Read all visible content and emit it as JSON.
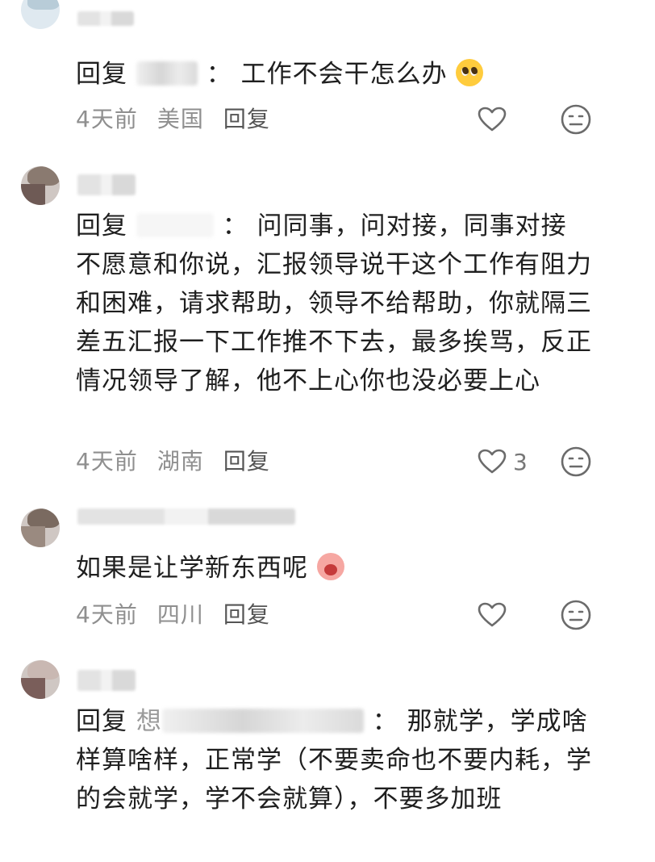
{
  "comments": [
    {
      "reply_label": "回复",
      "separator": "：",
      "text": "工作不会干怎么办",
      "time": "4天前",
      "location": "美国",
      "reply_button": "回复",
      "likes": ""
    },
    {
      "reply_label": "回复",
      "separator": "：",
      "text": "问同事，问对接，同事对接不愿意和你说，汇报领导说干这个工作有阻力和困难，请求帮助，领导不给帮助，你就隔三差五汇报一下工作推不下去，最多挨骂，反正情况领导了解，他不上心你也没必要上心",
      "time": "4天前",
      "location": "湖南",
      "reply_button": "回复",
      "likes": "3"
    },
    {
      "reply_label": "",
      "separator": "",
      "text": "如果是让学新东西呢",
      "time": "4天前",
      "location": "四川",
      "reply_button": "回复",
      "likes": ""
    },
    {
      "reply_label": "回复",
      "partial_name": "想",
      "separator": "：",
      "text": "那就学，学成啥样算啥样，正常学（不要卖命也不要内耗，学的会就学，学不会就算），不要多加班"
    }
  ],
  "icons": {
    "like": "heart-outline-icon",
    "dislike": "neutral-face-icon"
  }
}
